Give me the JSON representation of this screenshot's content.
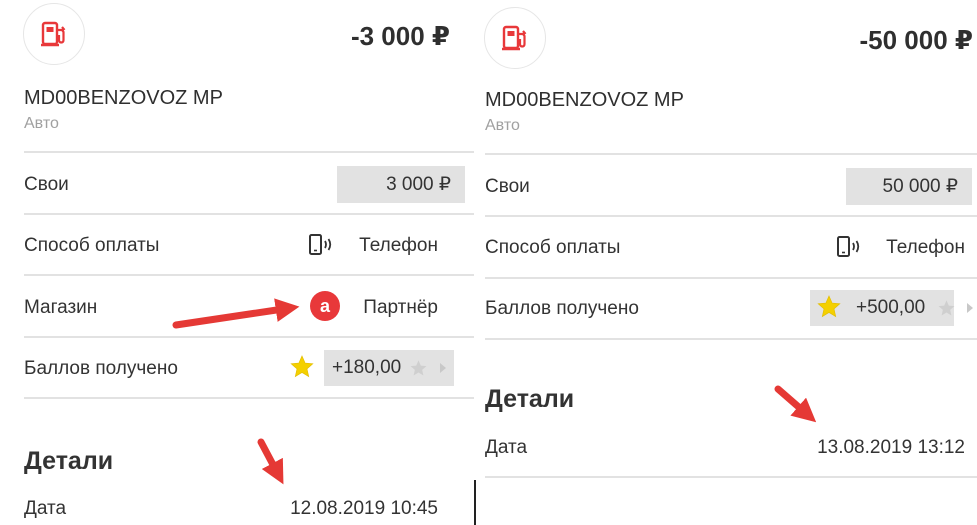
{
  "left": {
    "amount": "-3 000 ₽",
    "merchant": "MD00BENZOVOZ MP",
    "category": "Авто",
    "own_label": "Свои",
    "own_value": "3 000 ₽",
    "payment_label": "Способ оплаты",
    "payment_value": "Телефон",
    "shop_label": "Магазин",
    "shop_badge": "а",
    "shop_value": "Партнёр",
    "points_label": "Баллов получено",
    "points_value": "+180,00",
    "details_title": "Детали",
    "date_label": "Дата",
    "date_value": "12.08.2019 10:45"
  },
  "right": {
    "amount": "-50 000 ₽",
    "merchant": "MD00BENZOVOZ MP",
    "category": "Авто",
    "own_label": "Свои",
    "own_value": "50 000 ₽",
    "payment_label": "Способ оплаты",
    "payment_value": "Телефон",
    "points_label": "Баллов получено",
    "points_value": "+500,00",
    "details_title": "Детали",
    "date_label": "Дата",
    "date_value": "13.08.2019 13:12"
  },
  "icons": {
    "category_icon": "fuel-pump-icon",
    "payment_icon": "phone-nfc-icon",
    "points_icon": "star-icon",
    "annotation": "red-arrow-annotation"
  },
  "colors": {
    "accent": "#e8383a",
    "star": "#f4d000",
    "box_bg": "#e2e2e2",
    "muted": "#a0a0a0",
    "arrow": "#e53935"
  }
}
